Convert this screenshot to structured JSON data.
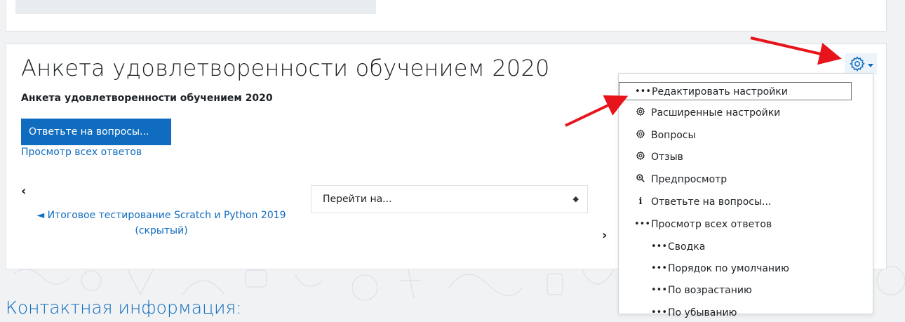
{
  "page": {
    "title": "Анкета удовлетворенности обучением 2020",
    "subtitle": "Анкета удовлетворенности обучением 2020",
    "respond_button": "Ответьте на вопросы...",
    "view_all_link": "Просмотр всех ответов",
    "prev_arrow": "‹",
    "prev_link": "◄ Итоговое тестирование Scratch и Python 2019 (скрытый)",
    "jump_placeholder": "Перейти на...",
    "next_arrow": "›",
    "contact_title": "Контактная информация:"
  },
  "settings_menu": {
    "gear_icon": "gear-icon",
    "items": [
      {
        "label": "Редактировать настройки",
        "icon": "dots-icon"
      },
      {
        "label": "Расширенные настройки",
        "icon": "gear-icon"
      },
      {
        "label": "Вопросы",
        "icon": "gear-icon"
      },
      {
        "label": "Отзыв",
        "icon": "gear-icon"
      },
      {
        "label": "Предпросмотр",
        "icon": "zoom-icon"
      },
      {
        "label": "Ответьте на вопросы...",
        "icon": "info-icon"
      },
      {
        "label": "Просмотр всех ответов",
        "icon": "dots-icon"
      },
      {
        "label": "Сводка",
        "icon": "dots-icon"
      },
      {
        "label": "Порядок по умолчанию",
        "icon": "dots-icon"
      },
      {
        "label": "По возрастанию",
        "icon": "dots-icon"
      },
      {
        "label": "По убыванию",
        "icon": "dots-icon"
      }
    ]
  },
  "colors": {
    "brand": "#0f6cbf",
    "annotation_arrow": "#e8141c"
  }
}
